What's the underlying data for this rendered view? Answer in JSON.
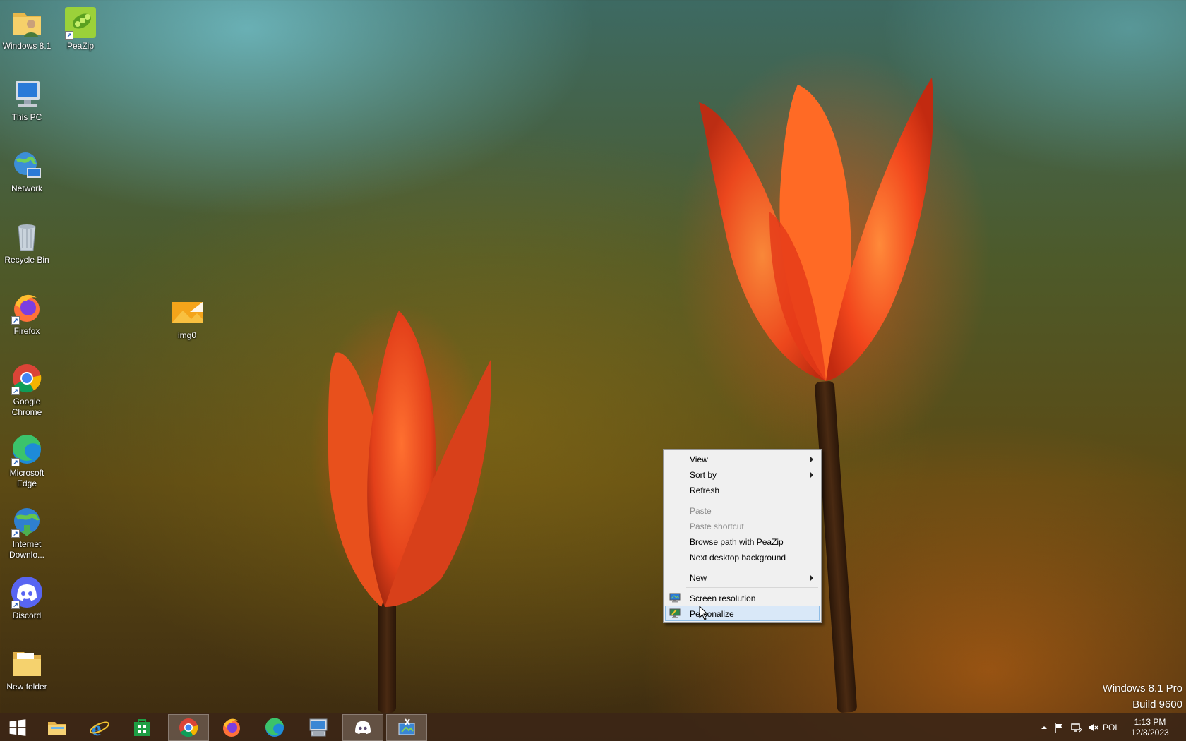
{
  "desktop": {
    "icons": [
      {
        "label": "Windows 8.1",
        "icon": "folder-user-icon"
      },
      {
        "label": "PeaZip",
        "icon": "peazip-icon"
      },
      {
        "label": "This PC",
        "icon": "this-pc-icon"
      },
      {
        "label": "Network",
        "icon": "network-icon"
      },
      {
        "label": "Recycle Bin",
        "icon": "recycle-bin-icon"
      },
      {
        "label": "Firefox",
        "icon": "firefox-icon"
      },
      {
        "label": "img0",
        "icon": "image-file-icon"
      },
      {
        "label": "Google Chrome",
        "icon": "chrome-icon"
      },
      {
        "label": "Microsoft Edge",
        "icon": "edge-icon"
      },
      {
        "label": "Internet Downlo...",
        "icon": "idm-icon"
      },
      {
        "label": "Discord",
        "icon": "discord-icon"
      },
      {
        "label": "New folder",
        "icon": "folder-icon"
      }
    ]
  },
  "context_menu": {
    "view": "View",
    "sort_by": "Sort by",
    "refresh": "Refresh",
    "paste": "Paste",
    "paste_shortcut": "Paste shortcut",
    "browse_peazip": "Browse path with PeaZip",
    "next_background": "Next desktop background",
    "new": "New",
    "screen_resolution": "Screen resolution",
    "personalize": "Personalize"
  },
  "watermark": {
    "line1": "Windows 8.1 Pro",
    "line2": "Build 9600"
  },
  "taskbar": {
    "pinned": [
      "start-icon",
      "file-explorer-icon",
      "internet-explorer-icon",
      "store-icon",
      "chrome-icon",
      "firefox-icon",
      "edge-icon",
      "remote-desktop-icon",
      "discord-icon",
      "snipping-tool-icon"
    ],
    "language": "POL",
    "time": "1:13 PM",
    "date": "12/8/2023"
  },
  "colors": {
    "menu_highlight": "#d9e8f8",
    "menu_highlight_border": "#8fbde6",
    "taskbar": "#3c2616"
  }
}
